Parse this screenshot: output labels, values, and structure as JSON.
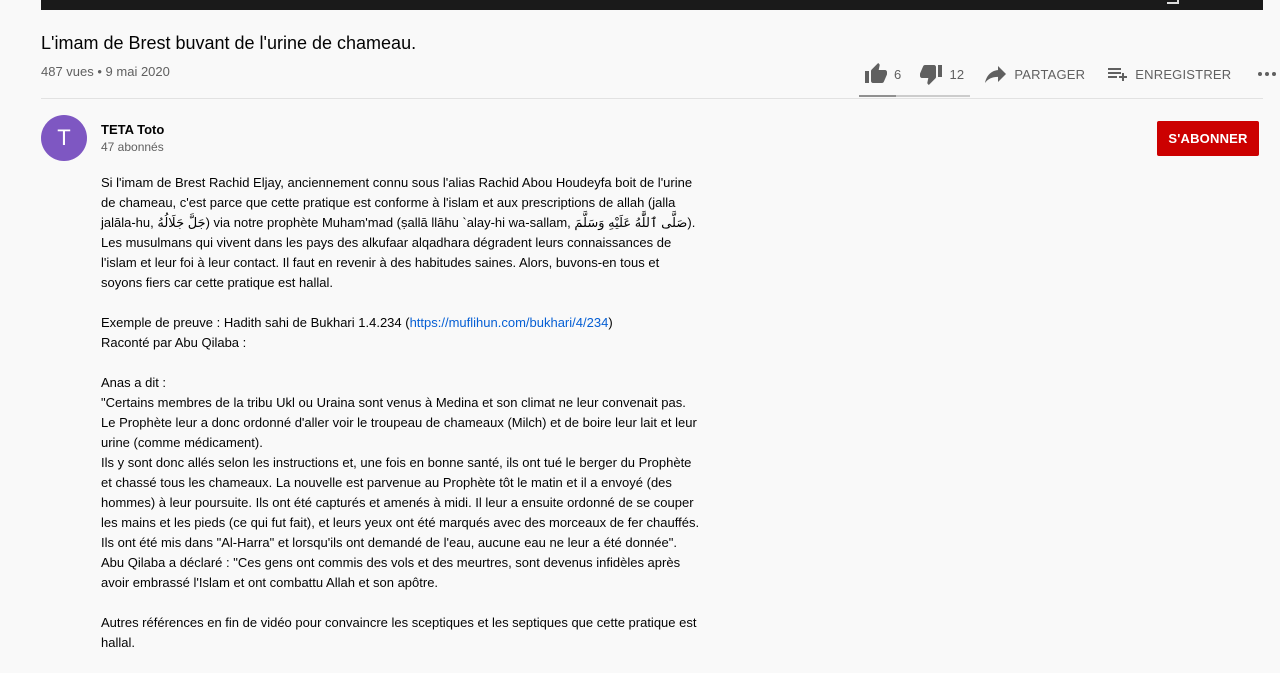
{
  "video": {
    "title": "L'imam de Brest buvant de l'urine de chameau.",
    "meta": "487 vues • 9 mai 2020",
    "likes": "6",
    "dislikes": "12",
    "like_ratio": 0.33,
    "share_label": "PARTAGER",
    "save_label": "ENREGISTRER"
  },
  "channel": {
    "avatar_letter": "T",
    "avatar_color": "#7e57c2",
    "name": "TETA Toto",
    "subscribers": "47 abonnés",
    "subscribe_label": "S'ABONNER",
    "subscribe_color": "#cc0000"
  },
  "icons": {
    "like": "thumb-up-icon",
    "dislike": "thumb-down-icon",
    "share": "share-arrow-icon",
    "save": "playlist-add-icon",
    "more": "more-horizontal-icon"
  },
  "description": {
    "p1": "Si l'imam de Brest Rachid Eljay, anciennement connu sous l'alias Rachid Abou Houdeyfa boit de l'urine de chameau, c'est parce que cette pratique est conforme à l'islam et aux prescriptions de allah (jalla jalāla-hu, جَلَّ جَلَالُهُ) via notre prophète Muham'mad (ṣallā llāhu `alay-hi wa-sallam, صَلَّى ٱللَّٰهُ عَلَيْهِ وَسَلَّمَ). Les musulmans qui vivent dans les pays des alkufaar alqadhara dégradent leurs connaissances de l'islam et leur foi à leur contact. Il faut en revenir à des habitudes saines. Alors, buvons-en tous et soyons fiers car cette pratique est hallal.",
    "p2_prefix": "Exemple de preuve : Hadith sahi de Bukhari 1.4.234 (",
    "p2_link": "https://muflihun.com/bukhari/4/234",
    "p2_suffix": ")",
    "p2_line2": "Raconté par Abu Qilaba :",
    "p3_line1": "Anas a dit :",
    "p3_line2": "\"Certains membres de la tribu Ukl ou Uraina sont venus à Medina et son climat ne leur convenait pas. Le Prophète leur a donc ordonné d'aller voir le troupeau de chameaux (Milch) et de boire leur lait et leur urine (comme médicament).",
    "p3_line3": "Ils y sont donc allés selon les instructions et, une fois en bonne santé, ils ont tué le berger du Prophète et chassé tous les chameaux. La nouvelle est parvenue au Prophète tôt le matin et il a envoyé (des hommes) à leur poursuite. Ils ont été capturés et amenés à midi. Il leur a ensuite ordonné de se couper les mains et les pieds (ce qui fut fait), et leurs yeux ont été marqués avec des morceaux de fer chauffés. Ils ont été mis dans \"Al-Harra\" et lorsqu'ils ont demandé de l'eau, aucune eau ne leur a été donnée\". Abu Qilaba a déclaré : \"Ces gens ont commis des vols et des meurtres, sont devenus infidèles après avoir embrassé l'Islam et ont combattu Allah et son apôtre.",
    "p4": "Autres références en fin de vidéo pour convaincre les sceptiques et les septiques que cette pratique est hallal."
  }
}
